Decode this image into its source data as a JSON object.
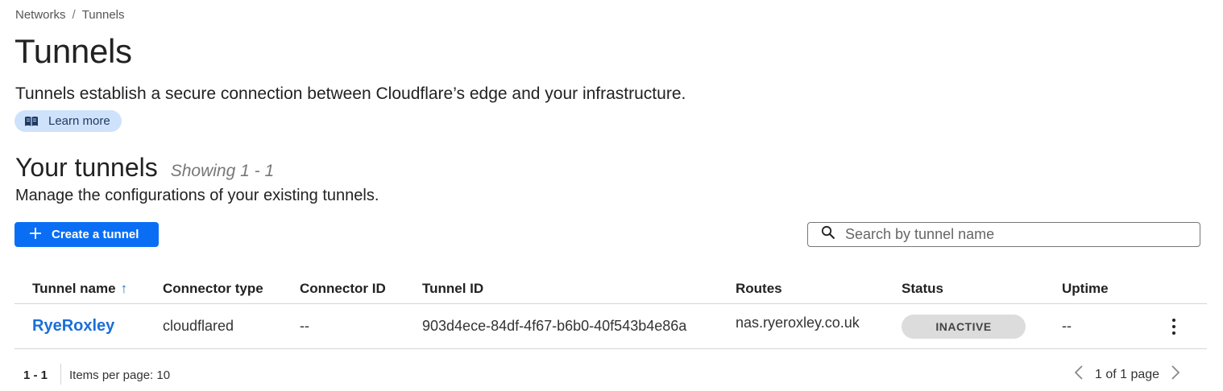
{
  "breadcrumb": {
    "items": [
      "Networks",
      "Tunnels"
    ],
    "separator": "/"
  },
  "page": {
    "title": "Tunnels",
    "description": "Tunnels establish a secure connection between Cloudflare’s edge and your infrastructure.",
    "learn_more_label": "Learn more"
  },
  "section": {
    "title": "Your tunnels",
    "showing": "Showing 1 - 1",
    "description": "Manage the configurations of your existing tunnels."
  },
  "toolbar": {
    "create_label": "Create a tunnel",
    "search_placeholder": "Search by tunnel name"
  },
  "table": {
    "columns": [
      "Tunnel name",
      "Connector type",
      "Connector ID",
      "Tunnel ID",
      "Routes",
      "Status",
      "Uptime"
    ],
    "sort_indicator": "↑",
    "rows": [
      {
        "tunnel_name": "RyeRoxley",
        "connector_type": "cloudflared",
        "connector_id": "--",
        "tunnel_id": "903d4ece-84df-4f67-b6b0-40f543b4e86a",
        "routes": "nas.ryeroxley.co.uk",
        "status": "INACTIVE",
        "uptime": "--"
      }
    ]
  },
  "pagination": {
    "range": "1 - 1",
    "items_per_page": "Items per page: 10",
    "page_label": "1 of 1 page"
  },
  "colors": {
    "accent": "#0a6ef5",
    "link": "#1a6fd8",
    "learn_more_bg": "#cfe2fb",
    "status_inactive_bg": "#dcdcdc"
  },
  "icons": [
    "book-icon",
    "plus-icon",
    "search-icon",
    "sort-up-icon",
    "kebab-menu-icon",
    "chevron-left-icon",
    "chevron-right-icon"
  ]
}
